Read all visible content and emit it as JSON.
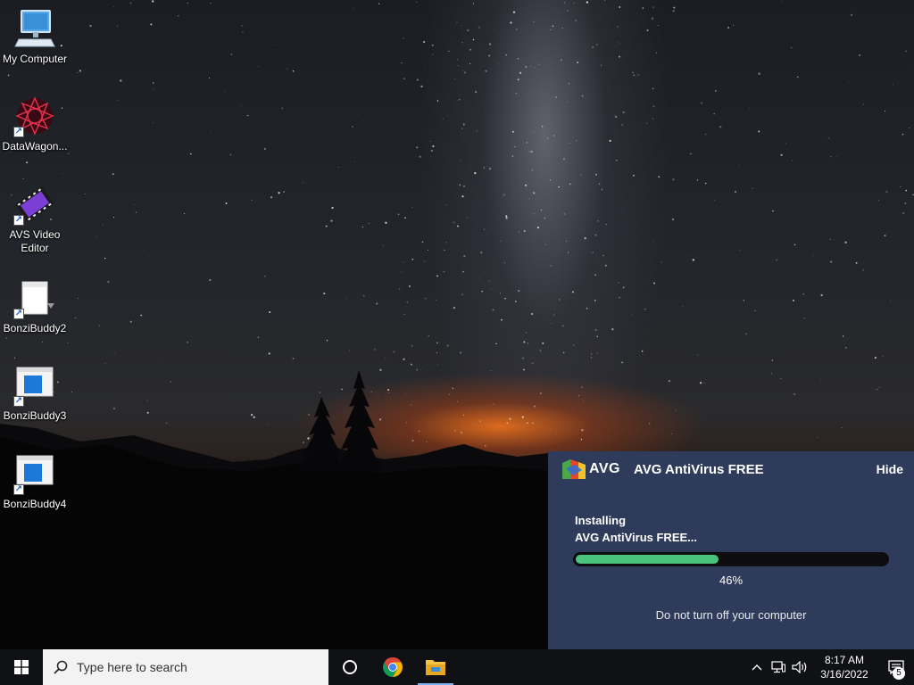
{
  "desktop": {
    "icons": [
      {
        "label": "My Computer"
      },
      {
        "label": "DataWagon..."
      },
      {
        "label": "AVS Video Editor"
      },
      {
        "label": "BonziBuddy2"
      },
      {
        "label": "BonziBuddy3"
      },
      {
        "label": "BonziBuddy4"
      }
    ]
  },
  "avg_window": {
    "logo_text": "AVG",
    "title": "AVG AntiVirus FREE",
    "hide_label": "Hide",
    "status_line1": "Installing",
    "status_line2": "AVG AntiVirus FREE...",
    "progress_fraction": 0.46,
    "progress_text": "46%",
    "note": "Do not turn off your computer",
    "colors": {
      "panel": "#2e3b5a",
      "progress": "#49c37d"
    }
  },
  "taskbar": {
    "search_placeholder": "Type here to search",
    "pinned": [
      {
        "icon": "cortana-icon"
      },
      {
        "icon": "chrome-icon"
      },
      {
        "icon": "file-explorer-icon",
        "active": true
      }
    ],
    "clock_time": "8:17 AM",
    "clock_date": "3/16/2022",
    "notification_count": "5"
  }
}
